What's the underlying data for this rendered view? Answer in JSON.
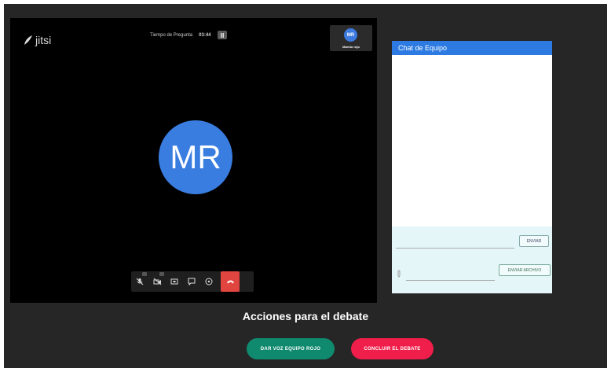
{
  "app": {
    "logo_text": "jitsi"
  },
  "timer": {
    "label": "Tiempo de Pregunta",
    "value": "03:44"
  },
  "participant": {
    "initials": "MR",
    "thumb_name": "Marido rojo"
  },
  "toolbar": {
    "icons": [
      "mic-muted-icon",
      "camera-off-icon",
      "screen-share-icon",
      "chat-icon",
      "more-icon",
      "hangup-icon"
    ]
  },
  "chat": {
    "title": "Chat de Equipo",
    "send_label": "ENVIAR",
    "send_file_label": "ENVIAR ARCHIVO"
  },
  "actions": {
    "title": "Acciones para el debate",
    "give_voice_label": "DAR VOZ EQUIPO ROJO",
    "end_debate_label": "CONCLUIR EL DEBATE"
  },
  "colors": {
    "avatar": "#3a7de0",
    "chat_header": "#2d7be2",
    "give_voice_button": "#0f8a6f",
    "end_debate_button": "#f01e4a",
    "hangup": "#e0453f"
  }
}
